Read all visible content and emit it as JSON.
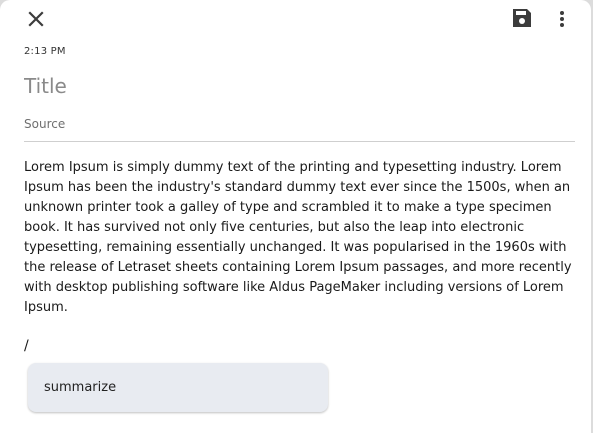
{
  "toolbar": {
    "close_icon": "close-icon",
    "save_icon": "save-icon",
    "more_icon": "more-vertical-icon"
  },
  "note": {
    "time": "2:13 PM",
    "title_placeholder": "Title",
    "title_value": "",
    "source_placeholder": "Source",
    "source_value": "",
    "body": "Lorem Ipsum is simply dummy text of the printing and typesetting industry. Lorem Ipsum has been the industry's standard dummy text ever since the 1500s, when an unknown printer took a galley of type and scrambled it to make a type specimen book. It has survived not only five centuries, but also the leap into electronic typesetting, remaining essentially unchanged. It was popularised in the 1960s with the release of Letraset sheets containing Lorem Ipsum passages, and more recently with desktop publishing software like Aldus PageMaker including versions of Lorem Ipsum.",
    "command_text": "/"
  },
  "command_menu": {
    "items": [
      {
        "label": "summarize"
      }
    ]
  },
  "colors": {
    "icon": "#3c3c3c",
    "menu_background": "#e8ebf1",
    "divider": "#cfcfcf"
  }
}
